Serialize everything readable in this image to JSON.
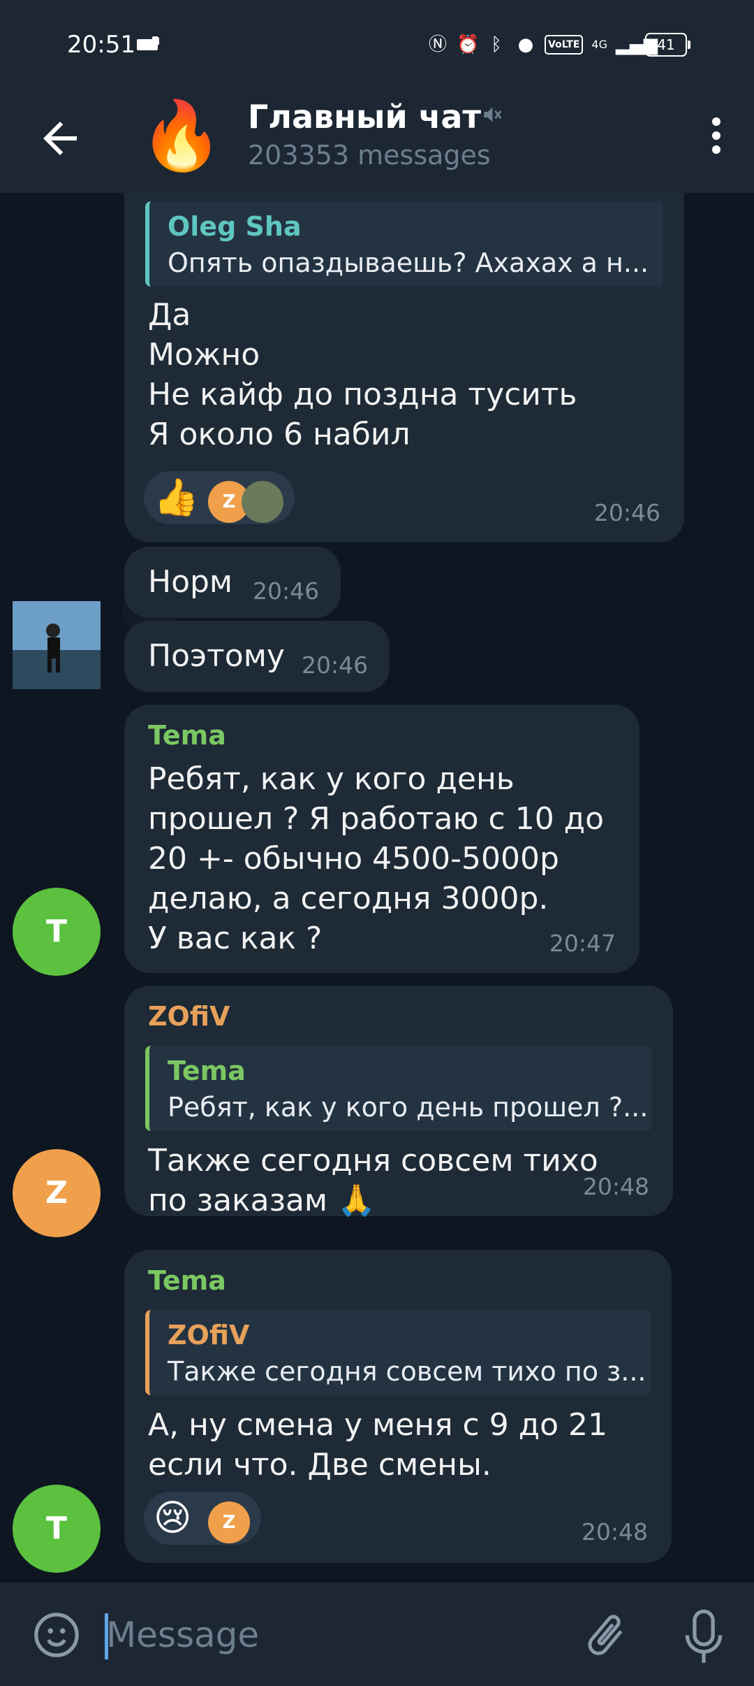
{
  "status": {
    "time": "20:51",
    "volte": "VoLTE",
    "network": "4G",
    "battery": "41"
  },
  "header": {
    "title": "Главный чат",
    "subtitle": "203353 messages",
    "avatar_emoji": "🔥"
  },
  "messages": [
    {
      "quote_name": "Oleg Sha",
      "quote_text": "Опять опаздываешь? Ахахах а н...",
      "text": "Да\nМожно\nНе кайф до поздна тусить\nЯ около 6 набил",
      "reaction": "👍",
      "reaction_users": [
        "Z",
        ""
      ],
      "time": "20:46"
    },
    {
      "text": "Норм",
      "time": "20:46"
    },
    {
      "text": "Поэтому",
      "time": "20:46"
    },
    {
      "sender": "Tema",
      "text": "Ребят, как у кого день\nпрошел ? Я работаю с 10 до\n20 +- обычно 4500-5000р\nделаю, а сегодня 3000р.\nУ вас как ?",
      "time": "20:47",
      "avatar_letter": "T"
    },
    {
      "sender": "ZOfiV",
      "quote_name": "Tema",
      "quote_text": "Ребят, как у кого день прошел ?...",
      "text": "Также сегодня совсем тихо\nпо заказам 🙏",
      "time": "20:48",
      "avatar_letter": "Z"
    },
    {
      "sender": "Tema",
      "quote_name": "ZOfiV",
      "quote_text": "Также сегодня совсем тихо по з...",
      "text": "А, ну смена у меня с 9 до 21\nесли что. Две смены.",
      "reaction": "😢",
      "reaction_users": [
        "Z"
      ],
      "time": "20:48",
      "avatar_letter": "T"
    }
  ],
  "input": {
    "placeholder": "Message"
  },
  "colors": {
    "tema": "#7bc862",
    "zofiv": "#e7a15a",
    "oleg": "#5fc6c0",
    "avatar_green": "#5bc13f",
    "avatar_orange": "#f0a04b"
  }
}
